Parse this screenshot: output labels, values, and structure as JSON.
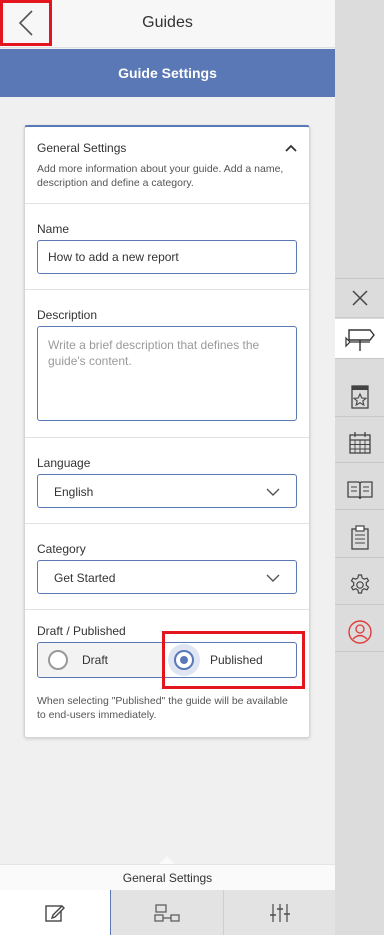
{
  "header": {
    "title": "Guides"
  },
  "banner": {
    "title": "Guide Settings"
  },
  "general": {
    "title": "General Settings",
    "description": "Add more information about your guide. Add a name, description and define a category."
  },
  "name_field": {
    "label": "Name",
    "value": "How to add a new report"
  },
  "description_field": {
    "label": "Description",
    "placeholder": "Write a brief description that defines the guide's content."
  },
  "language_field": {
    "label": "Language",
    "value": "English"
  },
  "category_field": {
    "label": "Category",
    "value": "Get Started"
  },
  "status_field": {
    "label": "Draft / Published",
    "options": [
      "Draft",
      "Published"
    ],
    "selected": "Published",
    "note": "When selecting \"Published\" the guide will be available to end-users immediately."
  },
  "footer": {
    "label": "General Settings"
  },
  "colors": {
    "accent": "#5a77b6",
    "highlight": "#e3161f"
  },
  "rail_icons": [
    "close-icon",
    "signpost-icon",
    "bookmark-star-icon",
    "calendar-icon",
    "book-icon",
    "clipboard-icon",
    "gear-icon",
    "user-profile-icon"
  ],
  "bottom_tab_icons": [
    "edit-icon",
    "flow-icon",
    "sliders-icon"
  ]
}
